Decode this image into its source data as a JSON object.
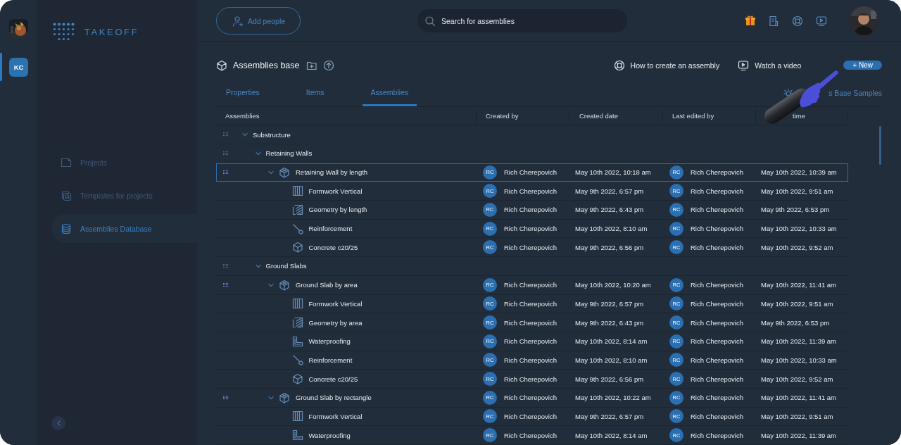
{
  "rail": {
    "items": [
      {
        "kind": "picture",
        "selected": false
      },
      {
        "kind": "initials",
        "label": "KC",
        "selected": true
      }
    ]
  },
  "sidebar": {
    "logo": "TAKEOFF",
    "items": [
      {
        "label": "Projects",
        "selected": false
      },
      {
        "label": "Templates for projects",
        "selected": false
      },
      {
        "label": "Assemblies Database",
        "selected": true
      }
    ]
  },
  "topbar": {
    "add_button": "Add people",
    "search": {
      "placeholder": "Search for assemblies"
    }
  },
  "toolbar": {
    "title": "Assemblies base",
    "help_link": "How to create an assembly",
    "video_link": "Watch a video",
    "new_button": "+ New"
  },
  "tabs": [
    {
      "label": "Properties",
      "selected": false
    },
    {
      "label": "Items",
      "selected": false
    },
    {
      "label": "Assemblies",
      "selected": true
    }
  ],
  "samples_link": "s Base Samples",
  "table": {
    "columns": [
      "Assemblies",
      "Created by",
      "Created date",
      "Last edited by",
      "time"
    ],
    "rows": [
      {
        "kind": "group",
        "name": "Substructure",
        "expanded": true,
        "selected": false,
        "children": [
          {
            "kind": "group",
            "name": "Retaining Walls",
            "expanded": true,
            "selected": false,
            "children": [
              {
                "kind": "assembly",
                "name": "Retaining Wall by length",
                "expanded": true,
                "selected": true,
                "created_by": {
                  "initials": "RC",
                  "name": "Rich Cherepovich"
                },
                "created_date": "May 10th 2022, 10:18 am",
                "last_edited_by": {
                  "initials": "RC",
                  "name": "Rich Cherepovich"
                },
                "last_edited_time": "May 10th 2022, 10:39 am",
                "children": [
                  {
                    "kind": "formwork",
                    "name": "Formwork Vertical",
                    "selected": false,
                    "created_by": {
                      "initials": "RC",
                      "name": "Rich Cherepovich"
                    },
                    "created_date": "May 9th 2022, 6:57 pm",
                    "last_edited_by": {
                      "initials": "RC",
                      "name": "Rich Cherepovich"
                    },
                    "last_edited_time": "May 10th 2022, 9:51 am"
                  },
                  {
                    "kind": "geometry",
                    "name": "Geometry by length",
                    "selected": false,
                    "created_by": {
                      "initials": "RC",
                      "name": "Rich Cherepovich"
                    },
                    "created_date": "May 9th 2022, 6:43 pm",
                    "last_edited_by": {
                      "initials": "RC",
                      "name": "Rich Cherepovich"
                    },
                    "last_edited_time": "May 9th 2022, 6:53 pm"
                  },
                  {
                    "kind": "reinforcement",
                    "name": "Reinforcement",
                    "selected": false,
                    "created_by": {
                      "initials": "RC",
                      "name": "Rich Cherepovich"
                    },
                    "created_date": "May 10th 2022, 8:10 am",
                    "last_edited_by": {
                      "initials": "RC",
                      "name": "Rich Cherepovich"
                    },
                    "last_edited_time": "May 10th 2022, 10:33 am"
                  },
                  {
                    "kind": "concrete",
                    "name": "Concrete c20/25",
                    "selected": false,
                    "created_by": {
                      "initials": "RC",
                      "name": "Rich Cherepovich"
                    },
                    "created_date": "May 9th 2022, 6:56 pm",
                    "last_edited_by": {
                      "initials": "RC",
                      "name": "Rich Cherepovich"
                    },
                    "last_edited_time": "May 10th 2022, 9:52 am"
                  }
                ]
              }
            ]
          },
          {
            "kind": "group",
            "name": "Ground Slabs",
            "expanded": true,
            "selected": false,
            "children": [
              {
                "kind": "assembly",
                "name": "Ground Slab by area",
                "expanded": true,
                "selected": false,
                "created_by": {
                  "initials": "RC",
                  "name": "Rich Cherepovich"
                },
                "created_date": "May 10th 2022, 10:20 am",
                "last_edited_by": {
                  "initials": "RC",
                  "name": "Rich Cherepovich"
                },
                "last_edited_time": "May 10th 2022, 11:41 am",
                "children": [
                  {
                    "kind": "formwork",
                    "name": "Formwork Vertical",
                    "selected": false,
                    "created_by": {
                      "initials": "RC",
                      "name": "Rich Cherepovich"
                    },
                    "created_date": "May 9th 2022, 6:57 pm",
                    "last_edited_by": {
                      "initials": "RC",
                      "name": "Rich Cherepovich"
                    },
                    "last_edited_time": "May 10th 2022, 9:51 am"
                  },
                  {
                    "kind": "geometry",
                    "name": "Geometry by area",
                    "selected": false,
                    "created_by": {
                      "initials": "RC",
                      "name": "Rich Cherepovich"
                    },
                    "created_date": "May 9th 2022, 6:43 pm",
                    "last_edited_by": {
                      "initials": "RC",
                      "name": "Rich Cherepovich"
                    },
                    "last_edited_time": "May 9th 2022, 6:53 pm"
                  },
                  {
                    "kind": "waterproofing",
                    "name": "Waterproofing",
                    "selected": false,
                    "created_by": {
                      "initials": "RC",
                      "name": "Rich Cherepovich"
                    },
                    "created_date": "May 10th 2022, 8:14 am",
                    "last_edited_by": {
                      "initials": "RC",
                      "name": "Rich Cherepovich"
                    },
                    "last_edited_time": "May 10th 2022, 11:39 am"
                  },
                  {
                    "kind": "reinforcement",
                    "name": "Reinforcement",
                    "selected": false,
                    "created_by": {
                      "initials": "RC",
                      "name": "Rich Cherepovich"
                    },
                    "created_date": "May 10th 2022, 8:10 am",
                    "last_edited_by": {
                      "initials": "RC",
                      "name": "Rich Cherepovich"
                    },
                    "last_edited_time": "May 10th 2022, 10:33 am"
                  },
                  {
                    "kind": "concrete",
                    "name": "Concrete c20/25",
                    "selected": false,
                    "created_by": {
                      "initials": "RC",
                      "name": "Rich Cherepovich"
                    },
                    "created_date": "May 9th 2022, 6:56 pm",
                    "last_edited_by": {
                      "initials": "RC",
                      "name": "Rich Cherepovich"
                    },
                    "last_edited_time": "May 10th 2022, 9:52 am"
                  }
                ]
              },
              {
                "kind": "assembly",
                "name": "Ground Slab by rectangle",
                "expanded": true,
                "selected": false,
                "created_by": {
                  "initials": "RC",
                  "name": "Rich Cherepovich"
                },
                "created_date": "May 10th 2022, 10:22 am",
                "last_edited_by": {
                  "initials": "RC",
                  "name": "Rich Cherepovich"
                },
                "last_edited_time": "May 10th 2022, 11:41 am",
                "children": [
                  {
                    "kind": "formwork",
                    "name": "Formwork Vertical",
                    "selected": false,
                    "created_by": {
                      "initials": "RC",
                      "name": "Rich Cherepovich"
                    },
                    "created_date": "May 9th 2022, 6:57 pm",
                    "last_edited_by": {
                      "initials": "RC",
                      "name": "Rich Cherepovich"
                    },
                    "last_edited_time": "May 10th 2022, 9:51 am"
                  },
                  {
                    "kind": "waterproofing",
                    "name": "Waterproofing",
                    "selected": false,
                    "created_by": {
                      "initials": "RC",
                      "name": "Rich Cherepovich"
                    },
                    "created_date": "May 10th 2022, 8:14 am",
                    "last_edited_by": {
                      "initials": "RC",
                      "name": "Rich Cherepovich"
                    },
                    "last_edited_time": "May 10th 2022, 11:39 am"
                  }
                ]
              }
            ]
          }
        ]
      }
    ]
  }
}
